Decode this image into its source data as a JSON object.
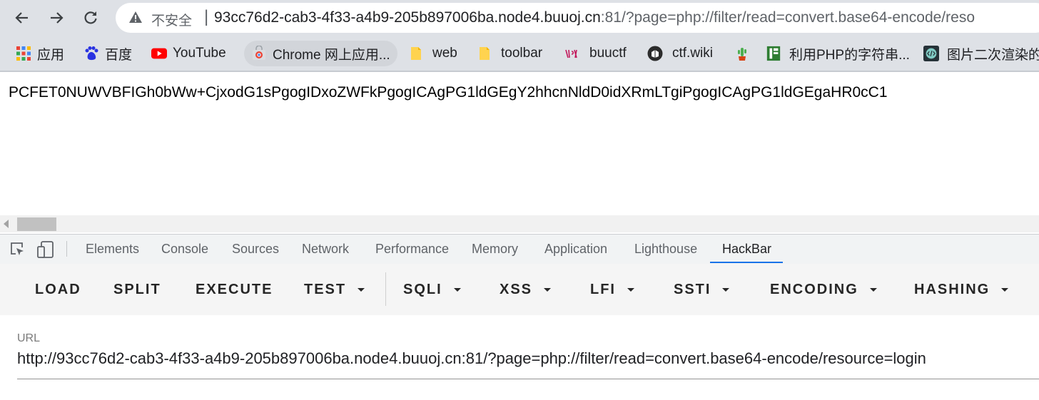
{
  "browser": {
    "insecure_label": "不安全",
    "url_host": "93cc76d2-cab3-4f33-a4b9-205b897006ba.node4.buuoj.cn",
    "url_rest": ":81/?page=php://filter/read=convert.base64-encode/reso"
  },
  "bookmarks": [
    {
      "label": "应用",
      "icon": "apps-grid-icon"
    },
    {
      "label": "百度",
      "icon": "baidu-icon"
    },
    {
      "label": "YouTube",
      "icon": "youtube-icon"
    },
    {
      "label": "Chrome 网上应用...",
      "icon": "chrome-webstore-icon"
    },
    {
      "label": "web",
      "icon": "folder-icon"
    },
    {
      "label": "toolbar",
      "icon": "folder-icon"
    },
    {
      "label": "buuctf",
      "icon": "buuctf-icon"
    },
    {
      "label": "ctf.wiki",
      "icon": "ctfwiki-icon"
    },
    {
      "label": "",
      "icon": "cactus-icon"
    },
    {
      "label": "利用PHP的字符串...",
      "icon": "green-doc-icon"
    },
    {
      "label": "图片二次渲染的",
      "icon": "code-icon"
    }
  ],
  "page": {
    "content": "PCFET0NUWVBFIGh0bWw+CjxodG1sPgogIDxoZWFkPgogICAgPG1ldGEgY2hhcnNldD0idXRmLTgiPgogICAgPG1ldGEgaHR0cC1"
  },
  "devtools": {
    "tabs": [
      "Elements",
      "Console",
      "Sources",
      "Network",
      "Performance",
      "Memory",
      "Application",
      "Lighthouse",
      "HackBar"
    ],
    "active_tab": "HackBar"
  },
  "hackbar": {
    "buttons": [
      "LOAD",
      "SPLIT",
      "EXECUTE"
    ],
    "dropdowns": [
      "TEST",
      "SQLI",
      "XSS",
      "LFI",
      "SSTI",
      "ENCODING",
      "HASHING"
    ],
    "url_label": "URL",
    "url_value": "http://93cc76d2-cab3-4f33-a4b9-205b897006ba.node4.buuoj.cn:81/?page=php://filter/read=convert.base64-encode/resource=login"
  },
  "colors": {
    "accent": "#1a73e8",
    "chrome_bg": "#dee1e6"
  }
}
